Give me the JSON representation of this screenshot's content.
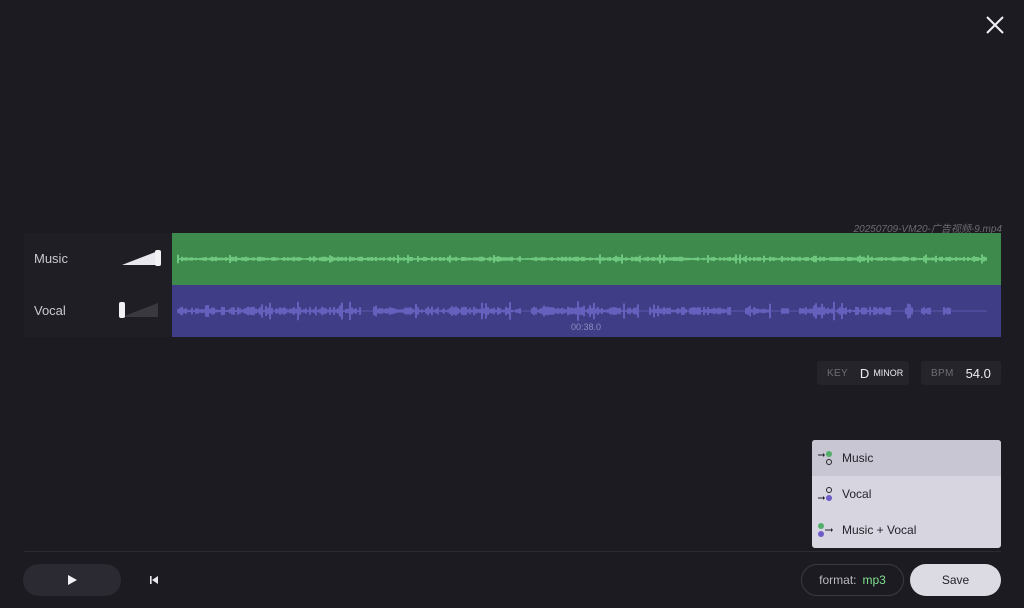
{
  "file": {
    "name": "20250709-VM20-广告视频-9.mp4"
  },
  "tracks": [
    {
      "name": "Music",
      "volume": 1.0,
      "color": "#3e8a4c",
      "wave_color": "#8ff0a0"
    },
    {
      "name": "Vocal",
      "volume": 0.0,
      "color": "#3f3d86",
      "wave_color": "#7f78e0"
    }
  ],
  "playhead": {
    "time": "00:38.0"
  },
  "analysis": {
    "key_label": "KEY",
    "key_note": "D",
    "key_mode": "minor",
    "bpm_label": "BPM",
    "bpm_value": "54.0"
  },
  "output_menu": {
    "selected": "Music",
    "items": [
      {
        "label": "Music",
        "icon": "music-output-icon"
      },
      {
        "label": "Vocal",
        "icon": "vocal-output-icon"
      },
      {
        "label": "Music + Vocal",
        "icon": "mix-output-icon"
      }
    ]
  },
  "controls": {
    "play_icon": "play-icon",
    "rewind_icon": "skip-back-icon",
    "format_label": "format:",
    "format_value": "mp3",
    "save_label": "Save",
    "close_icon": "close-icon"
  },
  "colors": {
    "background": "#1c1b21",
    "accent_green": "#7fe08f",
    "vocal_dot": "#6f5bc9",
    "music_dot": "#4fae68"
  }
}
